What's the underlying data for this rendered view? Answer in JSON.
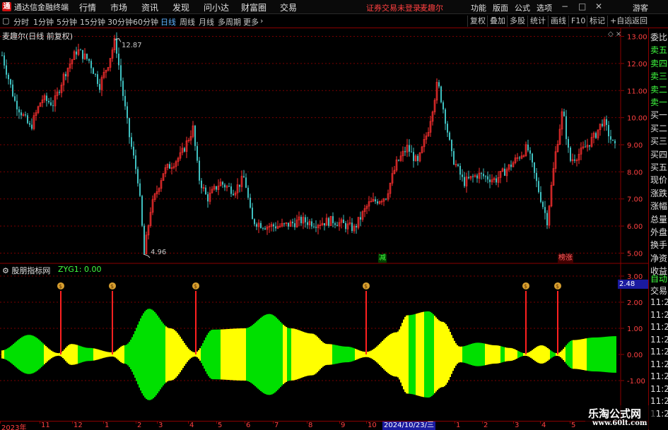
{
  "topbar": {
    "app_title": "通达信金融终端",
    "menu": [
      "行情",
      "市场",
      "资讯",
      "发现",
      "问小达",
      "财富圈",
      "交易"
    ],
    "status_warning": "证券交易未登录",
    "stock_name": "麦趣尔",
    "right_menu": [
      "功能",
      "版面",
      "公式",
      "选项"
    ],
    "guest": "游客"
  },
  "periodbar": {
    "periods": [
      "分时",
      "1分钟",
      "5分钟",
      "15分钟",
      "30分钟",
      "60分钟",
      "日线",
      "周线",
      "月线",
      "多周期",
      "更多"
    ],
    "active": "日线",
    "tools": [
      "复权",
      "叠加",
      "多股",
      "统计",
      "画线",
      "F10",
      "标记",
      "+自选",
      "返回"
    ]
  },
  "chart": {
    "title": "麦趣尔(日线 前复权)",
    "price_high": "12.87",
    "price_low": "4.96",
    "tag_minus": "减",
    "tag_list": "榜涨",
    "colors": {
      "up": "#ff3030",
      "down": "#3fc0c0",
      "grid": "#7a0000",
      "yellow": "#ffff00",
      "green": "#00e000"
    }
  },
  "indicator": {
    "title": "股朋指标网",
    "value_label": "ZYG1: 0.00",
    "current_value": "2.48"
  },
  "chart_data": {
    "type": "candlestick",
    "price_axis": [
      "13.00",
      "12.00",
      "11.00",
      "10.00",
      "9.00",
      "8.00",
      "7.00",
      "6.00",
      "5.00"
    ],
    "indicator_axis": [
      "3.00",
      "2.00",
      "1.00",
      "0.00",
      "-1.00"
    ],
    "date_labels": [
      "2023年",
      "11",
      "12",
      "1",
      "2",
      "3",
      "4",
      "5",
      "6",
      "7",
      "8",
      "9",
      "10",
      "2024/10/23/三",
      "1",
      "2",
      "3",
      "4",
      "5"
    ],
    "ylim": [
      4.7,
      13.3
    ]
  },
  "rightpanel": {
    "labels": [
      "委比",
      "卖五",
      "卖四",
      "卖三",
      "卖二",
      "卖一",
      "买一",
      "买二",
      "买三",
      "买四",
      "买五",
      "现价",
      "涨跌",
      "涨幅",
      "总量",
      "外盘",
      "换手",
      "净资",
      "收益"
    ],
    "auto_label": "自动",
    "trade_label": "交易",
    "times": [
      "11:29",
      "11:29",
      "11:29",
      "11:29",
      "11:29",
      "11:29",
      "11:29",
      "11:29",
      "11:29",
      "11:29"
    ]
  },
  "watermark": {
    "line1": "乐淘公式网",
    "line2": "www.60lt.com"
  }
}
